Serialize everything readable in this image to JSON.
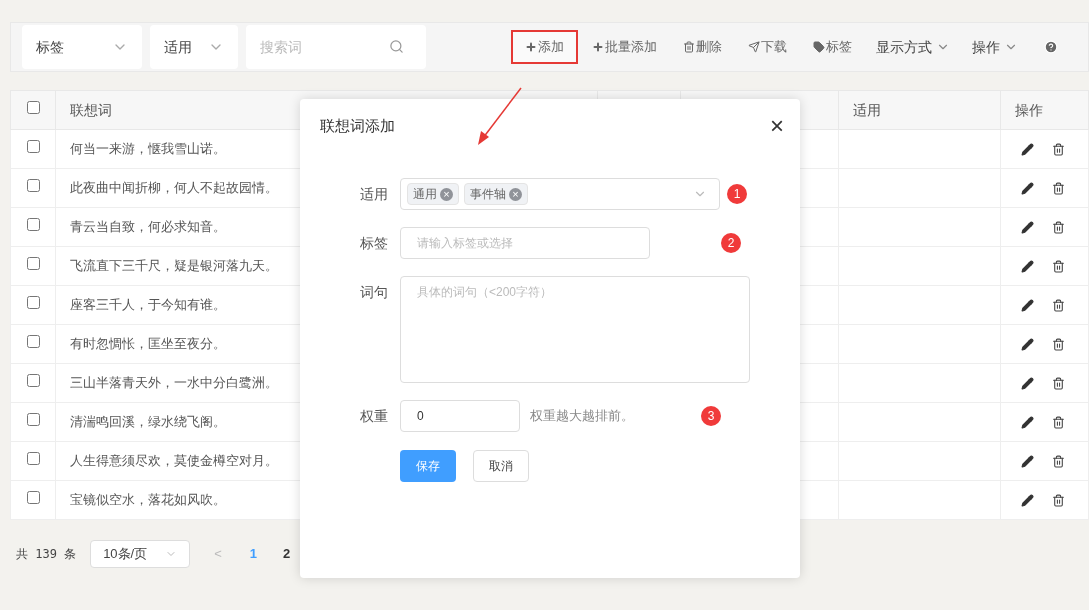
{
  "filters": [
    {
      "label": "标签"
    },
    {
      "label": "适用"
    }
  ],
  "search": {
    "placeholder": "搜索词"
  },
  "toolbar": [
    {
      "kind": "plus",
      "label": "添加",
      "highlighted": true
    },
    {
      "kind": "plus",
      "label": "批量添加",
      "highlighted": false
    },
    {
      "kind": "trash",
      "label": "删除",
      "highlighted": false
    },
    {
      "kind": "send",
      "label": "下载",
      "highlighted": false
    },
    {
      "kind": "tag",
      "label": "标签",
      "highlighted": false
    },
    {
      "kind": "dropdown",
      "label": "显示方式",
      "highlighted": false
    },
    {
      "kind": "dropdown",
      "label": "操作",
      "highlighted": false
    },
    {
      "kind": "help",
      "highlighted": false
    }
  ],
  "table": {
    "columns": [
      "联想词",
      "适用",
      "操作"
    ],
    "header_checked": false,
    "rows": [
      {
        "word": "何当一来游，惬我雪山诺。",
        "checked": false
      },
      {
        "word": "此夜曲中闻折柳，何人不起故园情。",
        "checked": false
      },
      {
        "word": "青云当自致，何必求知音。",
        "checked": false
      },
      {
        "word": "飞流直下三千尺，疑是银河落九天。",
        "checked": false
      },
      {
        "word": "座客三千人，于今知有谁。",
        "checked": false
      },
      {
        "word": "有时忽惆怅，匡坐至夜分。",
        "checked": false
      },
      {
        "word": "三山半落青天外，一水中分白鹭洲。",
        "checked": false
      },
      {
        "word": "清湍鸣回溪，绿水绕飞阁。",
        "checked": false
      },
      {
        "word": "人生得意须尽欢，莫使金樽空对月。",
        "checked": false
      },
      {
        "word": "宝镜似空水，落花如风吹。",
        "checked": false
      }
    ]
  },
  "pagination": {
    "total": "共 139 条",
    "page_size": "10条/页",
    "prev": "<",
    "pages": [
      {
        "label": "1",
        "selected": true
      },
      {
        "label": "2",
        "selected": false
      }
    ]
  },
  "dialog": {
    "title": "联想词添加",
    "close": "×",
    "fields": [
      {
        "kind": "tags",
        "label": "适用",
        "tags": [
          {
            "label": "通用",
            "remove": "×"
          },
          {
            "label": "事件轴",
            "remove": "×"
          }
        ],
        "marker": "1"
      },
      {
        "kind": "input",
        "label": "标签",
        "placeholder": "请输入标签或选择",
        "marker": "2"
      },
      {
        "kind": "textarea",
        "label": "词句",
        "placeholder": "具体的词句（<200字符）"
      },
      {
        "kind": "number",
        "label": "权重",
        "value": "0",
        "hint": "权重越大越排前。",
        "marker": "3"
      }
    ],
    "buttons": [
      {
        "kind": "primary",
        "label": "保存"
      },
      {
        "kind": "default",
        "label": "取消"
      }
    ]
  }
}
